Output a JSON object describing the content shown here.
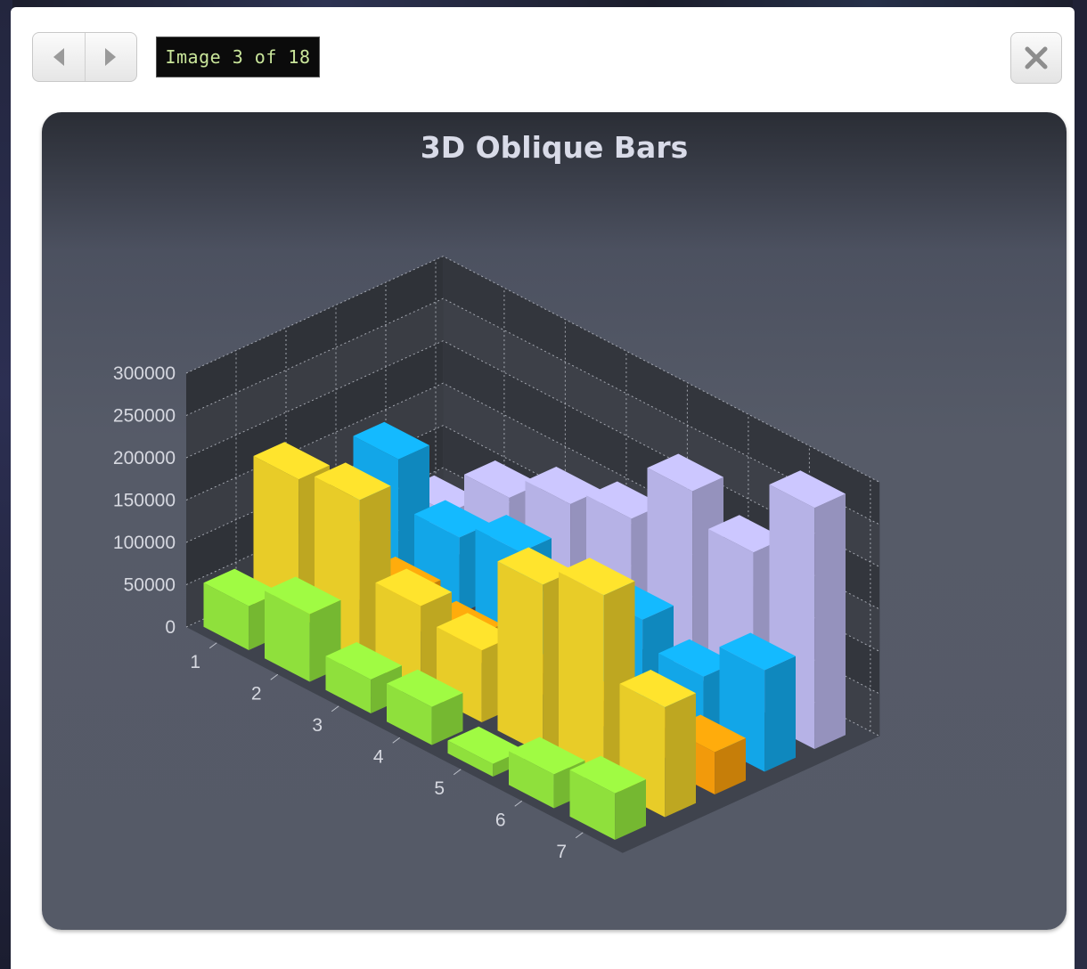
{
  "viewer": {
    "counter_text": "Image 3 of 18",
    "prev_icon": "triangle-left",
    "next_icon": "triangle-right",
    "close_icon": "close-x"
  },
  "chart_data": {
    "type": "bar",
    "subtype": "3d-oblique",
    "title": "3D Oblique Bars",
    "categories": [
      "1",
      "2",
      "3",
      "4",
      "5",
      "6",
      "7"
    ],
    "y_ticks": [
      "0",
      "50000",
      "100000",
      "150000",
      "200000",
      "250000",
      "300000"
    ],
    "ylim": [
      0,
      300000
    ],
    "grid": true,
    "series": [
      {
        "values": [
          52000,
          80000,
          40000,
          45000,
          15000,
          40000,
          55000
        ],
        "color": "#8fe03c"
      },
      {
        "values": [
          175000,
          188000,
          100000,
          85000,
          200000,
          225000,
          130000
        ],
        "color": "#e8cc28"
      },
      {
        "values": [
          70000,
          50000,
          35000,
          25000,
          30000,
          35000,
          50000
        ],
        "color": "#f29a0b"
      },
      {
        "values": [
          145000,
          90000,
          110000,
          70000,
          105000,
          75000,
          120000
        ],
        "color": "#12a6e8"
      },
      {
        "values": [
          55000,
          110000,
          140000,
          160000,
          230000,
          195000,
          285000
        ],
        "color": "#b6b2e6"
      }
    ]
  }
}
